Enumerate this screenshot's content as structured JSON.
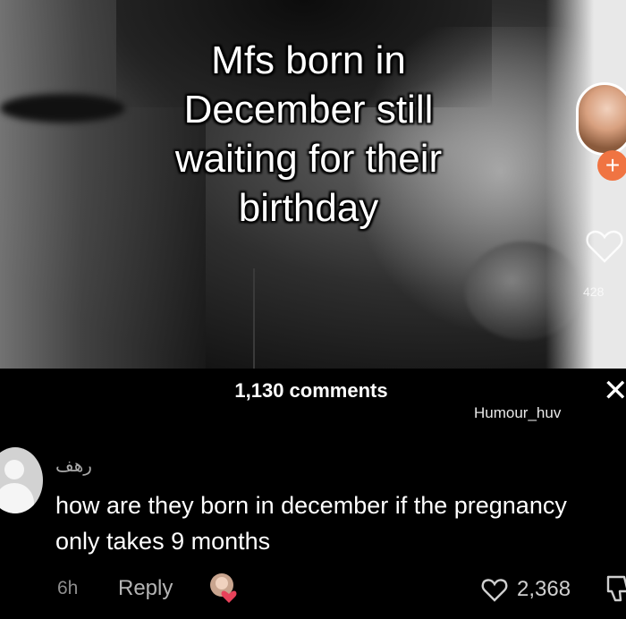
{
  "video": {
    "caption": "Mfs born in December still waiting for their birthday",
    "likes_count": "428",
    "follow_symbol": "+"
  },
  "comments_panel": {
    "title": "1,130 comments",
    "close_symbol": "✕",
    "watermark": "Humour_huv"
  },
  "comment": {
    "username": "رهف",
    "text": "how are they born in december if the pregnancy only takes 9 months",
    "time": "6h",
    "reply_label": "Reply",
    "like_count": "2,368"
  },
  "colors": {
    "follow_accent": "#f07442",
    "panel_background": "#000000",
    "like_heart": "#e8425a"
  },
  "icons": [
    "heart-outline-icon",
    "close-icon",
    "default-avatar-icon",
    "like-heart-icon",
    "dislike-icon"
  ]
}
